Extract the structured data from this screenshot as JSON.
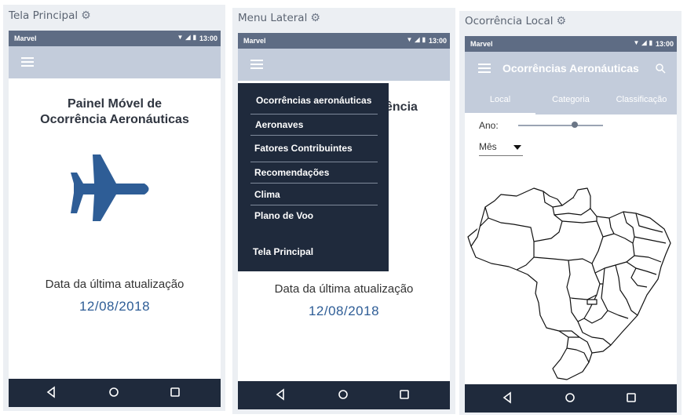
{
  "screens": {
    "main": {
      "board_title": "Tela Principal",
      "status": {
        "carrier": "Marvel",
        "time": "13:00"
      },
      "title": "Painel Móvel de Ocorrência Aeronáuticas",
      "update_label": "Data da última atualização",
      "update_date": "12/08/2018"
    },
    "menu": {
      "board_title": "Menu Lateral",
      "status": {
        "carrier": "Marvel",
        "time": "13:00"
      },
      "bg_title_partial": "ência",
      "update_label": "Data da última atualização",
      "update_date": "12/08/2018",
      "items": [
        "Ocorrências aeronáuticas",
        "Aeronaves",
        "Fatores Contribuintes",
        "Recomendações",
        "Clima",
        "Plano de Voo",
        "Tela Principal"
      ]
    },
    "local": {
      "board_title": "Ocorrência Local",
      "status": {
        "carrier": "Marvel",
        "time": "13:00"
      },
      "app_title": "Ocorrências Aeronáuticas",
      "tabs": [
        "Local",
        "Categoria",
        "Classificação"
      ],
      "year_label": "Ano:",
      "year_level": 0.67,
      "month_select": "Mês"
    }
  },
  "icons": {
    "gear": "gear-icon",
    "menu": "hamburger-menu-icon",
    "search": "search-icon",
    "back": "back-triangle-icon",
    "home": "home-circle-icon",
    "recent": "recent-apps-square-icon",
    "airplane": "airplane-icon",
    "dropdown": "dropdown-arrow-icon",
    "map": "brazil-states-map"
  },
  "colors": {
    "status_bar": "#5e6c84",
    "app_bar": "#c3ccdb",
    "nav_bar": "#1f2a3c",
    "accent": "#2e5d96",
    "menu_bg": "#1f2a3c"
  }
}
